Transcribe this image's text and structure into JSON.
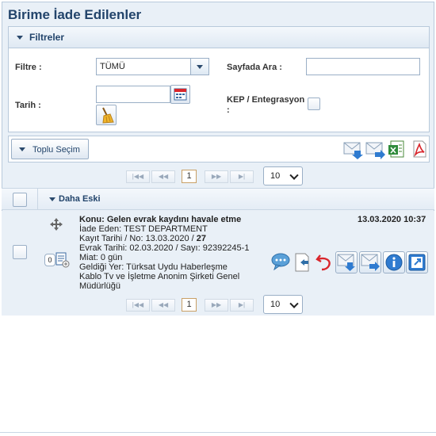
{
  "page": {
    "title": "Birime İade Edilenler"
  },
  "filters": {
    "header": "Filtreler",
    "filter_label": "Filtre :",
    "filter_value": "TÜMÜ",
    "search_label": "Sayfada Ara :",
    "search_value": "",
    "date_label": "Tarih :",
    "date_value": "",
    "kep_label_line1": "KEP / Entegrasyon",
    "kep_label_line2": ":"
  },
  "toolbar": {
    "bulk_select_label": "Toplu Seçim"
  },
  "pager_top": {
    "first": "|◀◀",
    "prev": "◀◀",
    "page": "1",
    "next": "▶▶",
    "last": "▶|",
    "page_size": "10"
  },
  "group": {
    "label": "Daha Eski"
  },
  "item": {
    "subject_prefix": "Konu: ",
    "subject": "Gelen evrak kaydını havale etme",
    "date": "13.03.2020 10:37",
    "returned_by_label": "İade Eden: ",
    "returned_by": "TEST DEPARTMENT",
    "record_label": "Kayıt Tarihi / No: ",
    "record_date": "13.03.2020 / ",
    "record_no": "27",
    "doc_line": "Evrak Tarihi: 02.03.2020 / Sayı: 92392245-1",
    "deadline": "Miat: 0 gün",
    "source_line1": "Geldiği Yer: Türksat Uydu Haberleşme",
    "source_line2": "Kablo Tv ve İşletme Anonim Şirketi Genel",
    "source_line3": "Müdürlüğü",
    "attachment_count": "0"
  },
  "pager_bottom": {
    "first": "|◀◀",
    "prev": "◀◀",
    "page": "1",
    "next": "▶▶",
    "last": "▶|",
    "page_size": "10"
  },
  "colors": {
    "title": "#22446b",
    "panel": "#e9f0f7",
    "border": "#b8c9db",
    "accent_red": "#d9262c"
  }
}
